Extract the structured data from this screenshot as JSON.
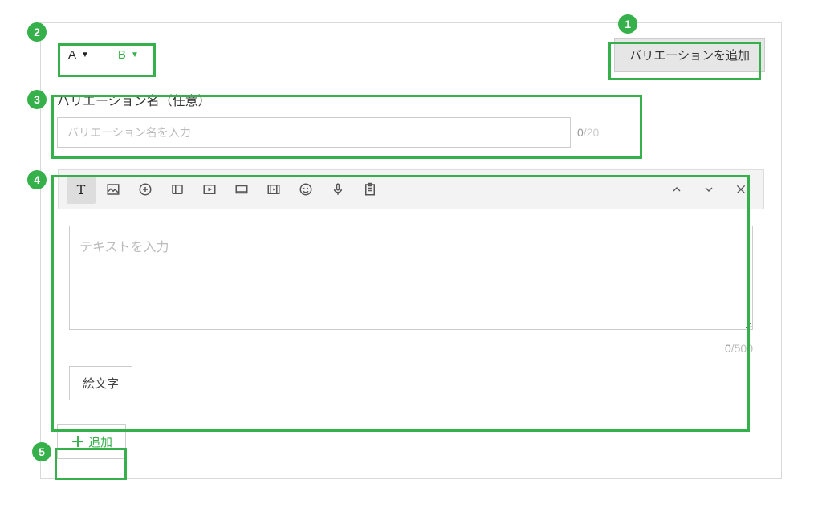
{
  "annotations": {
    "b1": "1",
    "b2": "2",
    "b3": "3",
    "b4": "4",
    "b5": "5"
  },
  "tabs": {
    "a_label": "A",
    "b_label": "B"
  },
  "buttons": {
    "add_variation": "バリエーションを追加",
    "emoji": "絵文字",
    "add_block": "追加"
  },
  "variation_name": {
    "label": "バリエーション名（任意）",
    "placeholder": "バリエーション名を入力",
    "count": "0",
    "limit": "/20"
  },
  "message": {
    "placeholder": "テキストを入力",
    "count": "0",
    "limit": "/500"
  },
  "toolbar_right": {
    "collapse": "collapse",
    "expand": "expand",
    "close": "close"
  }
}
